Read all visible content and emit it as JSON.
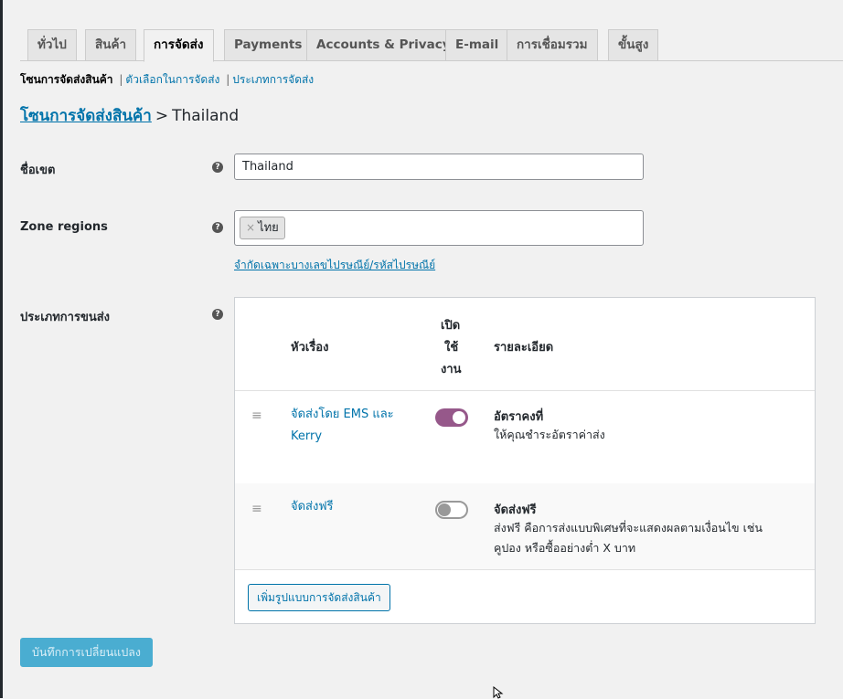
{
  "tabs": [
    "ทั่วไป",
    "สินค้า",
    "การจัดส่ง",
    "Payments",
    "Accounts & Privacy",
    "E-mail",
    "การเชื่อมรวม",
    "ขั้นสูง"
  ],
  "active_tab": "การจัดส่ง",
  "subnav": {
    "current": "โซนการจัดส่งสินค้า",
    "sep": "|",
    "link1": "ตัวเลือกในการจัดส่ง",
    "link2": "ประเภทการจัดส่ง"
  },
  "breadcrumb": {
    "link": "โซนการจัดส่งสินค้า",
    "sep": ">",
    "current": "Thailand"
  },
  "zone_name": {
    "label": "ชื่อเขต",
    "value": "Thailand"
  },
  "zone_regions": {
    "label": "Zone regions",
    "token": "ไทย",
    "remove": "×",
    "limit_link": "จำกัดเฉพาะบางเลขไปรษณีย์/รหัสไปรษณีย์"
  },
  "methods": {
    "label": "ประเภทการขนส่ง",
    "headers": {
      "title": "หัวเรื่อง",
      "enabled_1": "เปิด",
      "enabled_2": "ใช้",
      "enabled_3": "งาน",
      "desc": "รายละเอียด"
    },
    "rows": [
      {
        "name_1": "จัดส่งโดย EMS และ",
        "name_2": "Kerry",
        "enabled": true,
        "type": "อัตราคงที่",
        "desc_1": "ให้คุณชำระอัตราค่าส่ง",
        "desc_2": ""
      },
      {
        "name_1": "จัดส่งฟรี",
        "name_2": "",
        "enabled": false,
        "type": "จัดส่งฟรี",
        "desc_1": "ส่งฟรี คือการส่งแบบพิเศษที่จะแสดงผลตามเงื่อนไข เช่น",
        "desc_2": "คูปอง หรือซื้ออย่างต่ำ X บาท"
      }
    ],
    "add_button": "เพิ่มรูปแบบการจัดส่งสินค้า"
  },
  "help_icon": "?",
  "drag_icon": "≡",
  "save_button": "บันทึกการเปลี่ยนแปลง",
  "colors": {
    "accent": "#96588a",
    "link": "#0073aa",
    "save": "#2ea2cc"
  }
}
